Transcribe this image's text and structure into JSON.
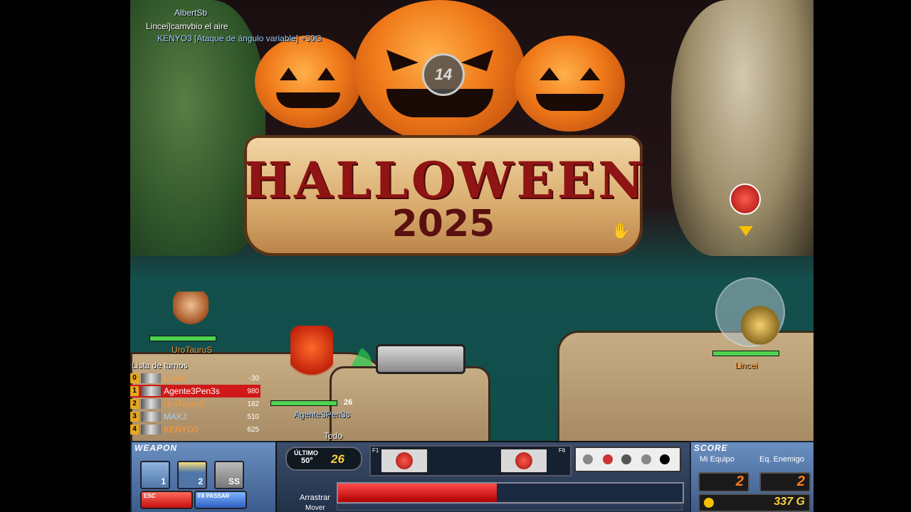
{
  "chat": {
    "player_top": "AlbertSb",
    "line1": "Lincei]camvbio el aire",
    "line2": "KENYO3 [Ataque de ángulo variable] +30G"
  },
  "banner": {
    "title": "HALLOWEEN",
    "year": "2025",
    "timer": "14"
  },
  "players": {
    "left": "UroTauruS",
    "center": "Agente3Pen3s",
    "center_power": "26",
    "right": "Lincei"
  },
  "turn_list": {
    "title": "Lista de turnos",
    "rows": [
      {
        "idx": "0",
        "name": "Lincei",
        "score": "-30",
        "color": "#ff9a3a"
      },
      {
        "idx": "1",
        "name": "Agente3Pen3s",
        "score": "980",
        "color": "#ffffff"
      },
      {
        "idx": "2",
        "name": "UroTauruS",
        "score": "182",
        "color": "#ff9a3a"
      },
      {
        "idx": "3",
        "name": "MAKJ",
        "score": "510",
        "color": "#9fd0ff"
      },
      {
        "idx": "4",
        "name": "KENYO3",
        "score": "625",
        "color": "#ff9a3a"
      }
    ]
  },
  "chat_mode": "Todo",
  "hud": {
    "weapon_title": "WEAPON",
    "slot1": "1",
    "slot2": "2",
    "slot3": "SS",
    "esc_label": "ESC",
    "f8_label": "F8 PASSAR",
    "last_label": "ÚLTIMO",
    "last_angle": "50°",
    "last_power": "26",
    "f1": "F1",
    "f6": "F6",
    "drag_label": "Arrastrar",
    "move_label": "Mover",
    "power_fill": 0.46,
    "score_title": "SCORE",
    "my_team": "Mi Equipo",
    "enemy_team": "Eq. Enemigo",
    "my_score": "2",
    "enemy_score": "2",
    "gold": "337 G"
  },
  "colors": {
    "accent_red": "#d01818",
    "hp_green": "#4fd34f",
    "score_orange": "#ff7b1c"
  }
}
